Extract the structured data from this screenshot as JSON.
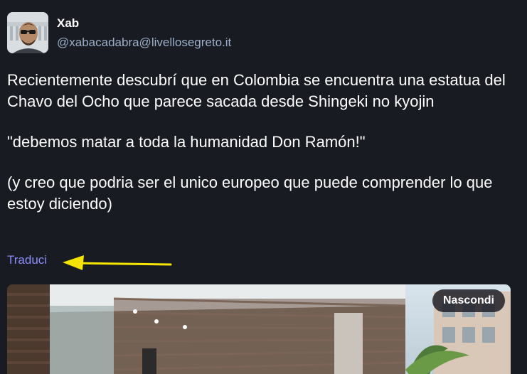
{
  "status": {
    "account": {
      "display_name": "Xab",
      "handle": "@xabacadabra@livellosegreto.it"
    },
    "content": {
      "paragraphs": [
        "Recientemente descubrí que en Colombia se encuentra una estatua del Chavo del Ocho que parece sacada desde Shingeki no kyojin",
        "\"debemos matar a toda la humanidad Don Ramón!\"",
        "(y creo que podria ser el unico europeo que puede comprender lo que estoy diciendo)"
      ]
    },
    "translate_label": "Traduci",
    "media": {
      "hide_label": "Nascondi"
    }
  },
  "colors": {
    "background": "#191b22",
    "link": "#8c8dff",
    "handle": "#9baec8",
    "arrow": "#f5e500"
  },
  "icons": {
    "annotation": "yellow-arrow-icon"
  }
}
